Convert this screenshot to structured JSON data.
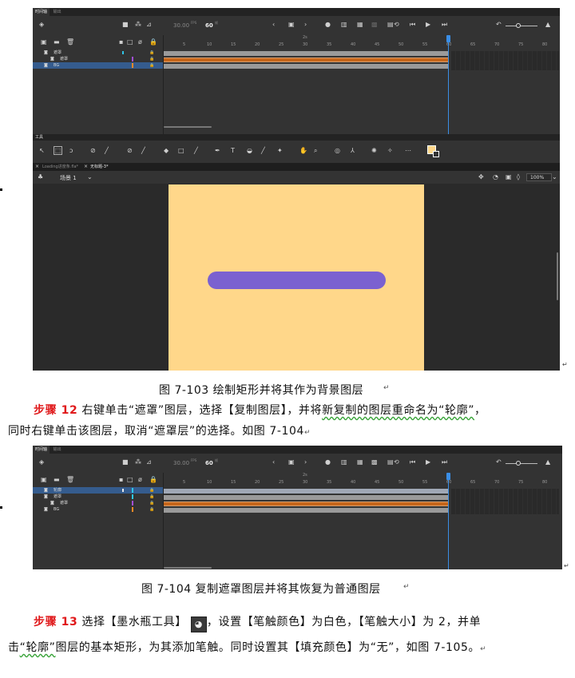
{
  "panel_common": {
    "tab_timeline": "时间轴",
    "tab_output": "输出",
    "fps": "30.00",
    "fps_unit": "FPS",
    "frame": "60",
    "frame_unit": "帧",
    "ruler_marks": [
      "5",
      "10",
      "15",
      "20",
      "25",
      "30",
      "35",
      "40",
      "45",
      "50",
      "55",
      "60",
      "65",
      "70",
      "75",
      "80"
    ],
    "ruler_second": "2s"
  },
  "figure1": {
    "layers": [
      {
        "name": "遮罩",
        "indent": false
      },
      {
        "name": "遮罩",
        "indent": true
      },
      {
        "name": "BG",
        "indent": false
      }
    ],
    "tools_title": "工具",
    "doc_tab_1": "Loading进度条.fla*",
    "doc_tab_2": "无标题-3*",
    "scene_label": "场景 1",
    "zoom": "100%",
    "stage_color": "#ffd78a",
    "bar_color": "#7b61d0",
    "caption": "图 7-103  绘制矩形并将其作为背景图层"
  },
  "step12": {
    "label": "步骤 12",
    "line1_a": "右键单击“遮罩”图层，选择【复制图层】，并将",
    "line1_b": "新复制的图层重命名为“轮廓”",
    "line1_c": "，",
    "line2": "同时右键单击该图层，取消“遮罩层”的选择。如图 7-104"
  },
  "figure2": {
    "layers": [
      {
        "name": "轮廓",
        "indent": false
      },
      {
        "name": "遮罩",
        "indent": false
      },
      {
        "name": "遮罩",
        "indent": true
      },
      {
        "name": "BG",
        "indent": false
      }
    ],
    "caption": "图 7-104  复制遮罩图层并将其恢复为普通图层"
  },
  "step13": {
    "label": "步骤 13",
    "line1_a": "选择【墨水瓶工具】",
    "line1_b": "，设置【笔触颜色】为白色，【笔触大小】为 2，并单",
    "line2_a": "击",
    "line2_b": "“轮廓”",
    "line2_c": "图层的基本矩形，为其添加笔触。同时设置其【填充颜色】为“无”，如图 7-105。"
  }
}
